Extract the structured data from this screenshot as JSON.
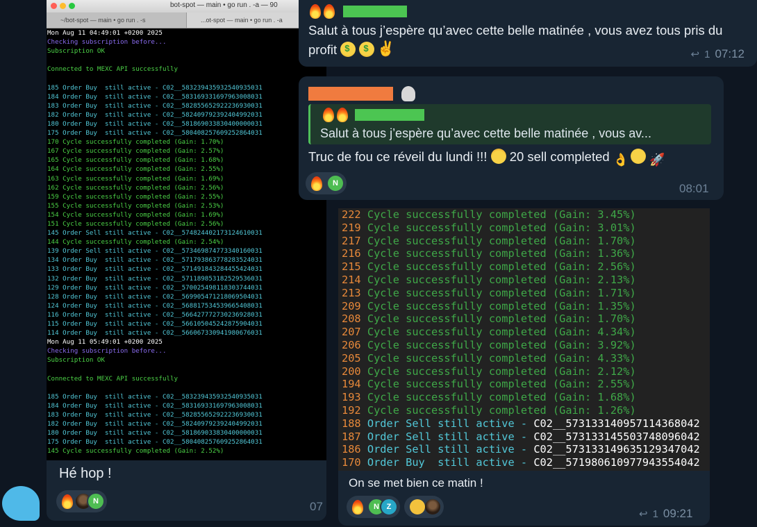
{
  "left_terminal": {
    "window_title": "bot-spot — main • go run . -a — 90",
    "tabs": [
      "~/bot-spot — main • go run . -s",
      "...ot-spot — main • go run . -a"
    ],
    "lines": [
      {
        "text": "Mon Aug 11 04:49:01 +0200 2025",
        "color": "white"
      },
      {
        "text": "Checking subscription before...",
        "color": "purple"
      },
      {
        "text": "Subscription OK",
        "color": "green"
      },
      {
        "text": "",
        "color": "white"
      },
      {
        "text": "Connected to MEXC API successfully",
        "color": "green"
      },
      {
        "text": "",
        "color": "white"
      },
      {
        "text": "185 Order Buy  still active - C02__583239435932540935031",
        "color": "cyan"
      },
      {
        "text": "184 Order Buy  still active - C02__583169331697963008031",
        "color": "cyan"
      },
      {
        "text": "183 Order Buy  still active - C02__582855652922236930031",
        "color": "cyan"
      },
      {
        "text": "182 Order Buy  still active - C02__582409792392404992031",
        "color": "cyan"
      },
      {
        "text": "180 Order Buy  still active - C02__581869033830400000031",
        "color": "cyan"
      },
      {
        "text": "175 Order Buy  still active - C02__580408257609252864031",
        "color": "cyan"
      },
      {
        "text": "170 Cycle successfully completed (Gain: 1.70%)",
        "color": "green"
      },
      {
        "text": "167 Cycle successfully completed (Gain: 2.57%)",
        "color": "green"
      },
      {
        "text": "165 Cycle successfully completed (Gain: 1.68%)",
        "color": "green"
      },
      {
        "text": "164 Cycle successfully completed (Gain: 2.55%)",
        "color": "green"
      },
      {
        "text": "163 Cycle successfully completed (Gain: 1.69%)",
        "color": "green"
      },
      {
        "text": "162 Cycle successfully completed (Gain: 2.56%)",
        "color": "green"
      },
      {
        "text": "159 Cycle successfully completed (Gain: 2.55%)",
        "color": "green"
      },
      {
        "text": "155 Cycle successfully completed (Gain: 2.53%)",
        "color": "green"
      },
      {
        "text": "154 Cycle successfully completed (Gain: 1.69%)",
        "color": "green"
      },
      {
        "text": "151 Cycle successfully completed (Gain: 2.56%)",
        "color": "green"
      },
      {
        "text": "145 Order Sell still active - C02__574824402173124610031",
        "color": "cyan"
      },
      {
        "text": "144 Cycle successfully completed (Gain: 2.54%)",
        "color": "green"
      },
      {
        "text": "139 Order Sell still active - C02__573469874773340160031",
        "color": "cyan"
      },
      {
        "text": "134 Order Buy  still active - C02__571793863778283524031",
        "color": "cyan"
      },
      {
        "text": "133 Order Buy  still active - C02__571491843284455424031",
        "color": "cyan"
      },
      {
        "text": "132 Order Buy  still active - C02__571189853182529536031",
        "color": "cyan"
      },
      {
        "text": "129 Order Buy  still active - C02__570025498118303744031",
        "color": "cyan"
      },
      {
        "text": "128 Order Buy  still active - C02__569905471218069504031",
        "color": "cyan"
      },
      {
        "text": "124 Order Buy  still active - C02__568817534539665408031",
        "color": "cyan"
      },
      {
        "text": "116 Order Buy  still active - C02__566427772730236928031",
        "color": "cyan"
      },
      {
        "text": "115 Order Buy  still active - C02__566105045242875904031",
        "color": "cyan"
      },
      {
        "text": "114 Order Buy  still active - C02__566067330941980676031",
        "color": "cyan"
      },
      {
        "text": "Mon Aug 11 05:49:01 +0200 2025",
        "color": "white"
      },
      {
        "text": "Checking subscription before...",
        "color": "purple"
      },
      {
        "text": "Subscription OK",
        "color": "green"
      },
      {
        "text": "",
        "color": "white"
      },
      {
        "text": "Connected to MEXC API successfully",
        "color": "green"
      },
      {
        "text": "",
        "color": "white"
      },
      {
        "text": "185 Order Buy  still active - C02__583239435932540935031",
        "color": "cyan"
      },
      {
        "text": "184 Order Buy  still active - C02__583169331697963008031",
        "color": "cyan"
      },
      {
        "text": "183 Order Buy  still active - C02__582855652922236930031",
        "color": "cyan"
      },
      {
        "text": "182 Order Buy  still active - C02__582409792392404992031",
        "color": "cyan"
      },
      {
        "text": "180 Order Buy  still active - C02__581869033830400000031",
        "color": "cyan"
      },
      {
        "text": "175 Order Buy  still active - C02__580408257609252864031",
        "color": "cyan"
      },
      {
        "text": "145 Cycle successfully completed (Gain: 2.52%)",
        "color": "green"
      }
    ]
  },
  "msg_he_hop": {
    "text": "Hé hop !",
    "time": "07"
  },
  "msg_salut": {
    "text": "Salut à tous j’espère qu’avec cette belle matinée , vous avez tous pris du profit",
    "reply_count": "1",
    "time": "07:12"
  },
  "msg_truc": {
    "quote_text": "Salut à tous j’espère qu’avec cette belle matinée , vous av...",
    "text": "Truc de fou ce réveil du lundi !!!",
    "text2": " 20 sell completed",
    "time": "08:01",
    "reaction_initial": "N"
  },
  "right_terminal": {
    "lines": [
      {
        "num": "222",
        "kind": "cycle",
        "text": "Cycle successfully completed (Gain: 3.45%)"
      },
      {
        "num": "219",
        "kind": "cycle",
        "text": "Cycle successfully completed (Gain: 3.01%)"
      },
      {
        "num": "217",
        "kind": "cycle",
        "text": "Cycle successfully completed (Gain: 1.70%)"
      },
      {
        "num": "216",
        "kind": "cycle",
        "text": "Cycle successfully completed (Gain: 1.36%)"
      },
      {
        "num": "215",
        "kind": "cycle",
        "text": "Cycle successfully completed (Gain: 2.56%)"
      },
      {
        "num": "214",
        "kind": "cycle",
        "text": "Cycle successfully completed (Gain: 2.13%)"
      },
      {
        "num": "213",
        "kind": "cycle",
        "text": "Cycle successfully completed (Gain: 1.71%)"
      },
      {
        "num": "209",
        "kind": "cycle",
        "text": "Cycle successfully completed (Gain: 1.35%)"
      },
      {
        "num": "208",
        "kind": "cycle",
        "text": "Cycle successfully completed (Gain: 1.70%)"
      },
      {
        "num": "207",
        "kind": "cycle",
        "text": "Cycle successfully completed (Gain: 4.34%)"
      },
      {
        "num": "206",
        "kind": "cycle",
        "text": "Cycle successfully completed (Gain: 3.92%)"
      },
      {
        "num": "205",
        "kind": "cycle",
        "text": "Cycle successfully completed (Gain: 4.33%)"
      },
      {
        "num": "200",
        "kind": "cycle",
        "text": "Cycle successfully completed (Gain: 2.12%)"
      },
      {
        "num": "194",
        "kind": "cycle",
        "text": "Cycle successfully completed (Gain: 2.55%)"
      },
      {
        "num": "193",
        "kind": "cycle",
        "text": "Cycle successfully completed (Gain: 1.68%)"
      },
      {
        "num": "192",
        "kind": "cycle",
        "text": "Cycle successfully completed (Gain: 1.26%)"
      },
      {
        "num": "188",
        "kind": "order",
        "text": "Order Sell still active - ",
        "id": "C02__573133140957114368042"
      },
      {
        "num": "187",
        "kind": "order",
        "text": "Order Sell still active - ",
        "id": "C02__573133145503748096042"
      },
      {
        "num": "186",
        "kind": "order",
        "text": "Order Sell still active - ",
        "id": "C02__573133149635129347042"
      },
      {
        "num": "170",
        "kind": "order",
        "text": "Order Buy  still active - ",
        "id": "C02__571980610977943554042"
      }
    ]
  },
  "msg_on_se_met": {
    "text": "On se met bien ce matin !",
    "reply_count": "1",
    "time": "09:21",
    "reaction_initials": [
      "N",
      "Z"
    ]
  },
  "colors": {
    "background": "#0e1621",
    "bubble": "#182533",
    "name_green": "#4cc552",
    "name_orange": "#f07b3f"
  }
}
